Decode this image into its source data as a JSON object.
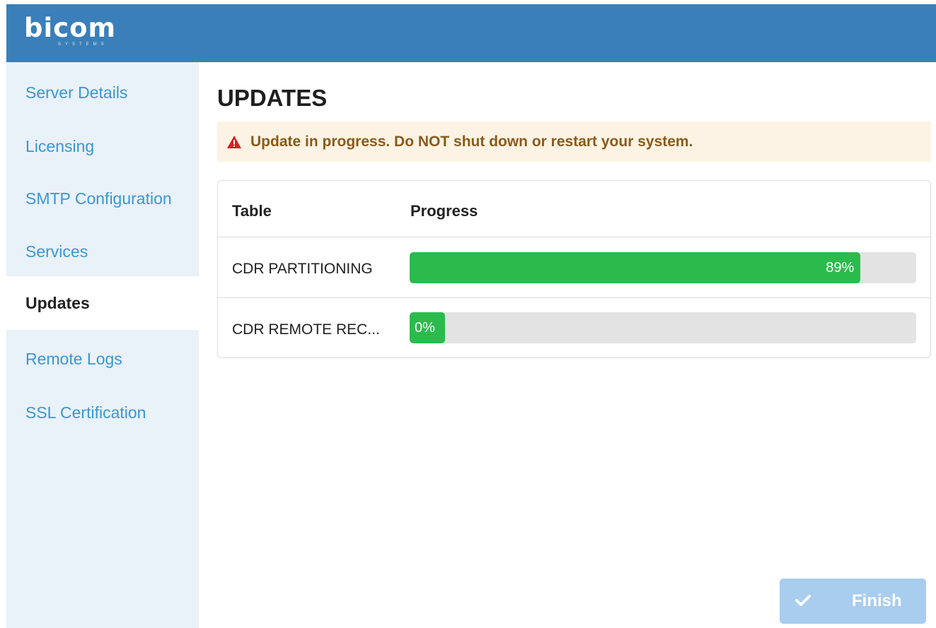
{
  "header": {
    "logo_text": "bicom",
    "logo_subtext": "SYSTEMS",
    "background_color": "#3a7fb9"
  },
  "sidebar": {
    "items": [
      {
        "label": "Server Details",
        "active": false
      },
      {
        "label": "Licensing",
        "active": false
      },
      {
        "label": "SMTP Configuration",
        "active": false
      },
      {
        "label": "Services",
        "active": false
      },
      {
        "label": "Updates",
        "active": true
      },
      {
        "label": "Remote Logs",
        "active": false
      },
      {
        "label": "SSL Certification",
        "active": false
      }
    ]
  },
  "main": {
    "title": "UPDATES",
    "alert": {
      "icon": "warning-icon",
      "text": "Update in progress. Do NOT shut down or restart your system.",
      "background_color": "#fdf3e4",
      "text_color": "#8a5a1c"
    },
    "table": {
      "columns": [
        "Table",
        "Progress"
      ],
      "rows": [
        {
          "name": "CDR PARTITIONING",
          "progress": 0.89,
          "progress_label": "89%"
        },
        {
          "name": "CDR REMOTE REC...",
          "progress": 0.0,
          "progress_label": "0%"
        }
      ],
      "progress_color": "#2bbb4c"
    }
  },
  "footer": {
    "finish_label": "Finish",
    "finish_icon": "check-icon",
    "finish_disabled": true
  }
}
